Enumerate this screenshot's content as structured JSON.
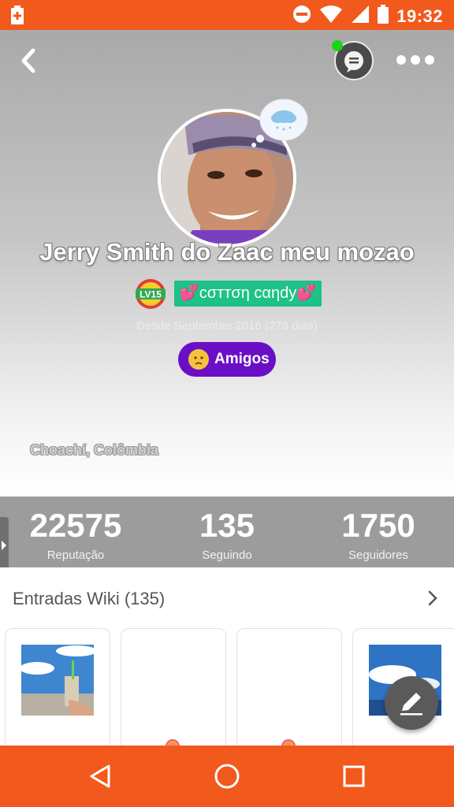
{
  "status_bar": {
    "time": "19:32"
  },
  "profile": {
    "name": "Jerry Smith do Zaac meu mozao",
    "level_badge": "LV15",
    "tag": "💕cσттση cαηdy💕",
    "since": "Desde September 2016 (278 dias)",
    "relationship_button": "Amigos",
    "location": "Choachí, Colômbia"
  },
  "stats": [
    {
      "value": "22575",
      "label": "Reputação"
    },
    {
      "value": "135",
      "label": "Seguindo"
    },
    {
      "value": "1750",
      "label": "Seguidores"
    }
  ],
  "wiki": {
    "title": "Entradas Wiki (135)"
  },
  "colors": {
    "accent": "#f2591d",
    "tag_green": "#1ec287",
    "friends_purple": "#6b0fc7",
    "online_green": "#19d419"
  },
  "icons": [
    "battery-alert-icon",
    "do-not-disturb-icon",
    "wifi-icon",
    "signal-icon",
    "battery-icon",
    "back-icon",
    "chat-icon",
    "more-icon",
    "weather-thought-icon",
    "level-badge-icon",
    "emoji-icon",
    "chevron-right-icon",
    "edit-icon",
    "nav-back-icon",
    "nav-home-icon",
    "nav-recents-icon"
  ]
}
